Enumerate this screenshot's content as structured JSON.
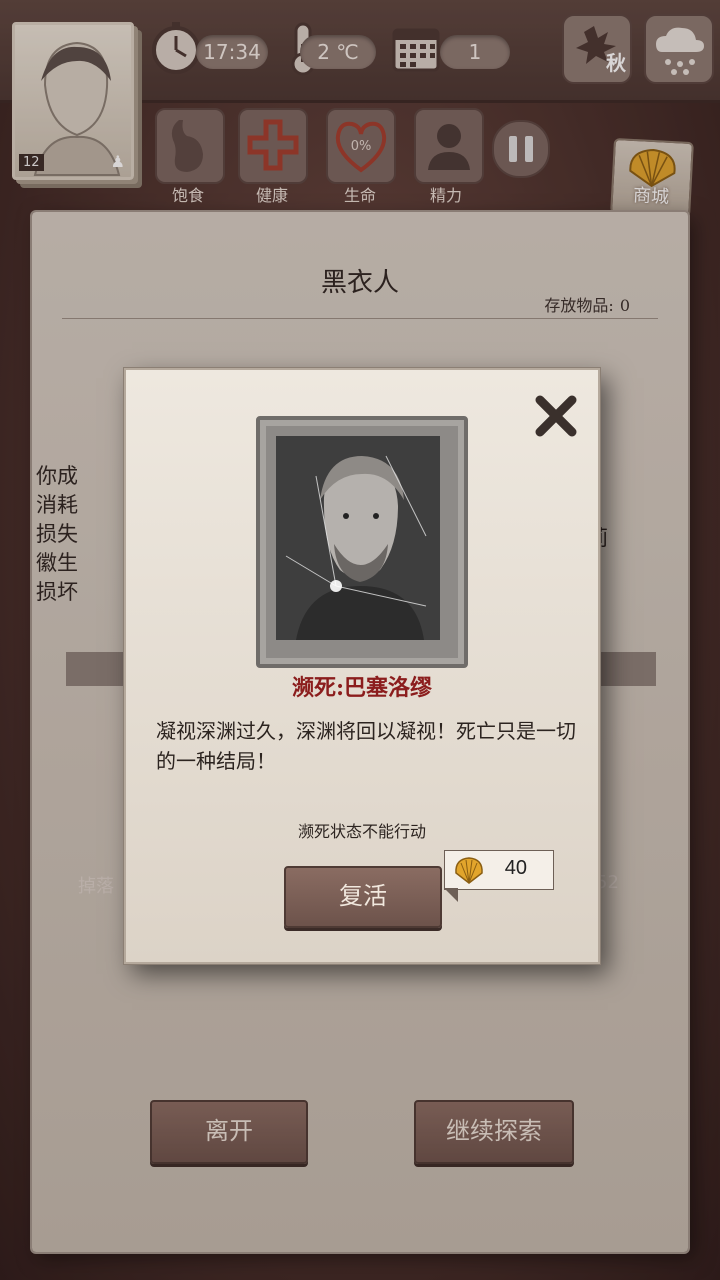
{
  "topbar": {
    "player_level": "12",
    "time": "17:34",
    "temperature": "2 ℃",
    "day": "1",
    "season": "秋"
  },
  "status": {
    "satiety_label": "饱食",
    "health_label": "健康",
    "life_label": "生命",
    "life_value": "0%",
    "energy_label": "精力"
  },
  "shop": {
    "label": "商城"
  },
  "background": {
    "title": "黑衣人",
    "stored_label": "存放物品:",
    "stored_count": "0",
    "side_text_lines": [
      "你成",
      "消耗",
      "损失",
      "徽生",
      "损坏"
    ],
    "side_right": "奥莉",
    "bar_left": "掉落",
    "bar_right": "52",
    "leave_button": "离开",
    "continue_button": "继续探索"
  },
  "dialog": {
    "hero_name": "濒死:巴塞洛缪",
    "description": "凝视深渊过久，深渊将回以凝视！死亡只是一切的一种结局！",
    "hint": "濒死状态不能行动",
    "revive_button": "复活",
    "revive_cost": "40"
  },
  "colors": {
    "accent_red": "#8b1d1d",
    "wood": "#7a5e55",
    "paper": "#e6dfd5"
  }
}
